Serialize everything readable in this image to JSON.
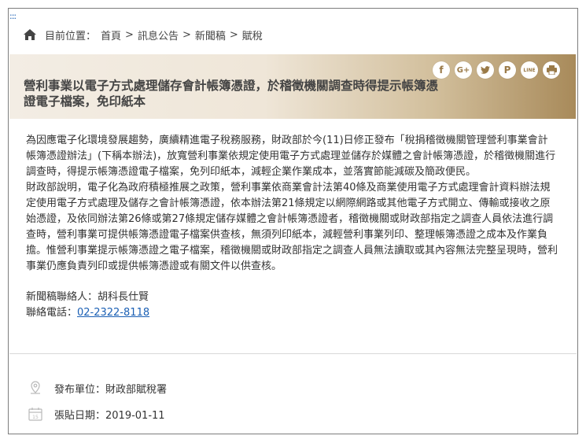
{
  "accesskey": ":::",
  "breadcrumb": {
    "prefix": "目前位置：",
    "items": [
      "首頁",
      "訊息公告",
      "新聞稿",
      "賦稅"
    ],
    "separator": ">"
  },
  "article": {
    "title": "營利事業以電子方式處理儲存會計帳簿憑證，於稽徵機關調查時得提示帳簿憑證電子檔案，免印紙本",
    "paragraph1": "為因應電子化環境發展趨勢，廣續精進電子稅務服務，財政部於今(11)日修正發布「稅捐稽徵機關管理營利事業會計帳簿憑證辦法」(下稱本辦法)，放寬營利事業依規定使用電子方式處理並儲存於媒體之會計帳簿憑證，於稽徵機關進行調查時，得提示帳簿憑證電子檔案，免列印紙本，減輕企業作業成本，並落實節能減碳及簡政便民。",
    "paragraph2": "財政部說明，電子化為政府積極推展之政策，營利事業依商業會計法第40條及商業使用電子方式處理會計資料辦法規定使用電子方式處理及儲存之會計帳簿憑證，依本辦法第21條規定以網際網路或其他電子方式開立、傳輸或接收之原始憑證，及依同辦法第26條或第27條規定儲存媒體之會計帳簿憑證者，稽徵機關或財政部指定之調查人員依法進行調查時，營利事業可提供帳簿憑證電子檔案供查核，無須列印紙本，減輕營利事業列印、整理帳簿憑證之成本及作業負擔。惟營利事業提示帳簿憑證之電子檔案，稽徵機關或財政部指定之調查人員無法讀取或其內容無法完整呈現時，營利事業仍應負責列印或提供帳簿憑證或有關文件以供查核。",
    "contact_label": "新聞稿聯絡人：胡科長仕賢",
    "phone_label": "聯絡電話：",
    "phone_number": "02-2322-8118"
  },
  "share": {
    "facebook": "f",
    "google_plus": "G+",
    "twitter": "🐦",
    "pinterest": "P",
    "line": "LINE",
    "print": "🖶"
  },
  "meta": {
    "publisher": "發布單位：財政部賦稅署",
    "date": "張貼日期：2019-01-11",
    "calendar_day": "15"
  },
  "colors": {
    "accent": "#9a7a48",
    "link": "#1a5fb4"
  }
}
